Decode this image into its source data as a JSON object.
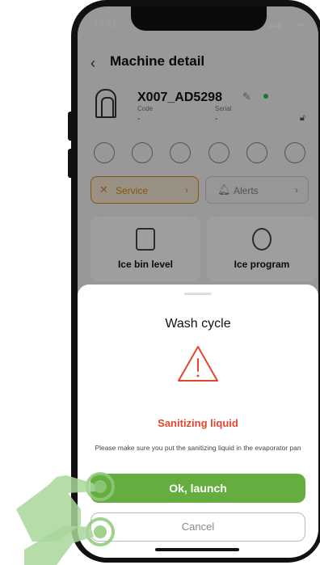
{
  "status_bar": {
    "time": "15:21"
  },
  "header": {
    "title": "Machine detail"
  },
  "machine": {
    "id": "X007_AD5298",
    "code_label": "Code",
    "code_value": "-",
    "serial_label": "Serial",
    "serial_value": "-"
  },
  "actions": {
    "service_label": "Service",
    "alerts_label": "Alerts"
  },
  "cards": [
    {
      "label": "Ice bin level"
    },
    {
      "label": "Ice program"
    }
  ],
  "sheet": {
    "title": "Wash cycle",
    "warning_title": "Sanitizing liquid",
    "warning_text": "Please make sure you put the sanitizing liquid in the evaporator pan",
    "ok_label": "Ok, launch",
    "cancel_label": "Cancel"
  },
  "colors": {
    "accent_green": "#66ad3f",
    "warning_red": "#e2462e",
    "service_orange": "#d98b1e",
    "online_green": "#2fbf4a"
  }
}
